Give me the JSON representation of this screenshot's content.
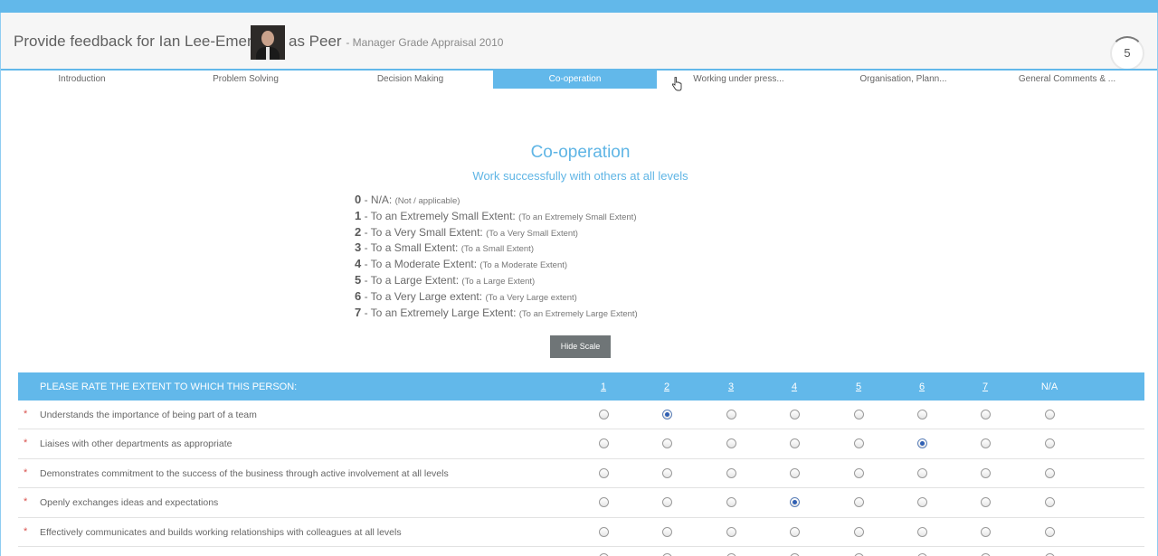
{
  "header": {
    "title_prefix": "Provide feedback for Ian Lee-Emery",
    "role": "as Peer",
    "subtitle": "- Manager Grade Appraisal 2010",
    "counter": "5"
  },
  "tabs": [
    {
      "label": "Introduction",
      "active": false
    },
    {
      "label": "Problem Solving",
      "active": false
    },
    {
      "label": "Decision Making",
      "active": false
    },
    {
      "label": "Co-operation",
      "active": true
    },
    {
      "label": "Working under press...",
      "active": false
    },
    {
      "label": "Organisation, Plann...",
      "active": false
    },
    {
      "label": "General Comments & ...",
      "active": false
    }
  ],
  "section": {
    "title": "Co-operation",
    "subtitle": "Work successfully with others at all levels"
  },
  "scale": [
    {
      "num": "0",
      "text": " - N/A: ",
      "note": "(Not / applicable)"
    },
    {
      "num": "1",
      "text": " - To an Extremely Small Extent: ",
      "note": "(To an Extremely Small Extent)"
    },
    {
      "num": "2",
      "text": " - To a Very Small Extent: ",
      "note": "(To a Very Small Extent)"
    },
    {
      "num": "3",
      "text": " - To a Small Extent: ",
      "note": "(To a Small Extent)"
    },
    {
      "num": "4",
      "text": " - To a Moderate Extent: ",
      "note": "(To a Moderate Extent)"
    },
    {
      "num": "5",
      "text": " - To a Large Extent: ",
      "note": "(To a Large Extent)"
    },
    {
      "num": "6",
      "text": " - To a Very Large extent: ",
      "note": "(To a Very Large extent)"
    },
    {
      "num": "7",
      "text": " - To an Extremely Large Extent: ",
      "note": "(To an Extremely Large Extent)"
    }
  ],
  "hide_scale_label": "Hide Scale",
  "rating": {
    "header": "PLEASE RATE THE EXTENT TO WHICH THIS PERSON:",
    "columns": [
      "1",
      "2",
      "3",
      "4",
      "5",
      "6",
      "7",
      "N/A"
    ],
    "rows": [
      {
        "label": "Understands the importance of being part of a team",
        "selected": "2"
      },
      {
        "label": "Liaises with other departments as appropriate",
        "selected": "6"
      },
      {
        "label": "Demonstrates commitment to the success of the business through active involvement at all levels",
        "selected": null
      },
      {
        "label": "Openly exchanges ideas and expectations",
        "selected": "4"
      },
      {
        "label": "Effectively communicates and builds working relationships with colleagues at all levels",
        "selected": null
      }
    ]
  },
  "colors": {
    "accent": "#62b8ea",
    "title": "#5fb5e5",
    "required_star": "#d9534f",
    "button": "#6f7577"
  }
}
